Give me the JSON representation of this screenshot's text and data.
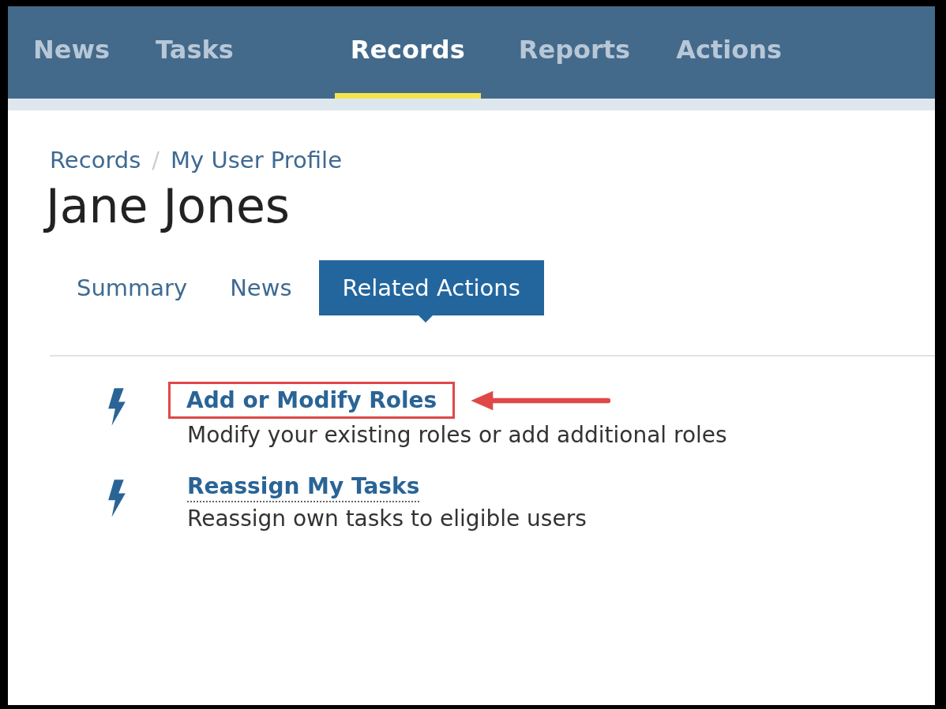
{
  "nav": [
    {
      "label": "News",
      "selected": false
    },
    {
      "label": "Tasks",
      "selected": false
    },
    {
      "label": "Records",
      "selected": true
    },
    {
      "label": "Reports",
      "selected": false
    },
    {
      "label": "Actions",
      "selected": false
    }
  ],
  "breadcrumb": [
    "Records",
    "My User Profile"
  ],
  "breadcrumb_separator": "/",
  "title": "Jane Jones",
  "tabs": [
    {
      "label": "Summary",
      "selected": false
    },
    {
      "label": "News",
      "selected": false
    },
    {
      "label": "Related Actions",
      "selected": true
    }
  ],
  "actions": [
    {
      "title": "Add or Modify Roles",
      "description": "Modify your existing roles or add additional roles",
      "highlighted": true
    },
    {
      "title": "Reassign My Tasks",
      "description": "Reassign own tasks to eligible users",
      "highlighted": false
    }
  ]
}
